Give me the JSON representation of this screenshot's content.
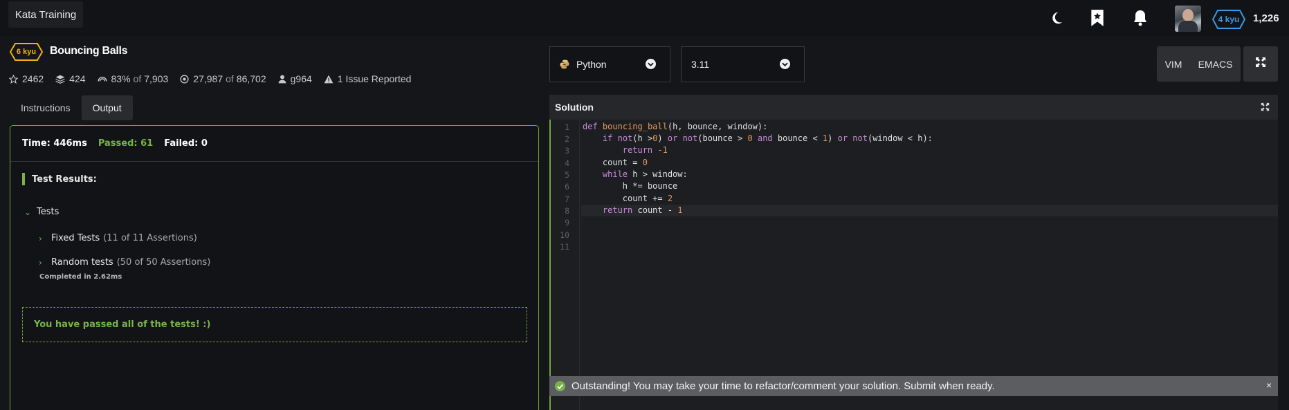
{
  "topbar": {
    "kata_training": "Kata Training",
    "icons": [
      "moon-icon",
      "bookmark-star-icon",
      "bell-icon"
    ],
    "rank": "4 kyu",
    "honor": "1,226"
  },
  "kata": {
    "rank": "6 kyu",
    "title": "Bouncing Balls",
    "stats": {
      "stars": "2462",
      "collections": "424",
      "satisfaction_pct": "83%",
      "satisfaction_of": "of",
      "satisfaction_votes": "7,903",
      "completed": "27,987",
      "completed_of": "of",
      "attempted": "86,702",
      "author": "g964",
      "issues": "1 Issue Reported"
    }
  },
  "tabs": [
    "Instructions",
    "Output"
  ],
  "output": {
    "time": "Time: 446ms",
    "passed": "Passed: 61",
    "failed": "Failed: 0",
    "results_title": "Test Results:",
    "tests_label": "Tests",
    "groups": [
      {
        "label": "Fixed Tests",
        "assertions": "(11 of 11 Assertions)"
      },
      {
        "label": "Random tests",
        "assertions": "(50 of 50 Assertions)"
      }
    ],
    "completed": "Completed in 2.62ms",
    "passed_message": "You have passed all of the tests! :)"
  },
  "editor_controls": {
    "language": "Python",
    "version": "3.11",
    "modes": [
      "VIM",
      "EMACS"
    ]
  },
  "solution": {
    "title": "Solution",
    "line_numbers": [
      "1",
      "2",
      "3",
      "4",
      "5",
      "6",
      "7",
      "8",
      "9",
      "10",
      "11"
    ],
    "code": [
      "def bouncing_ball(h, bounce, window):",
      "    if not(h >0) or not(bounce > 0 and bounce < 1) or not(window < h):",
      "        return -1",
      "    count = 0",
      "    while h > window:",
      "        h *= bounce",
      "        count += 2",
      "    return count - 1",
      "",
      "",
      ""
    ]
  },
  "toast": {
    "message": "Outstanding! You may take your time to refactor/comment your solution. Submit when ready.",
    "close": "×"
  },
  "colors": {
    "accent_green": "#78b34a",
    "kyu6_yellow": "#ecb613",
    "kyu4_blue": "#3c9ae3"
  }
}
